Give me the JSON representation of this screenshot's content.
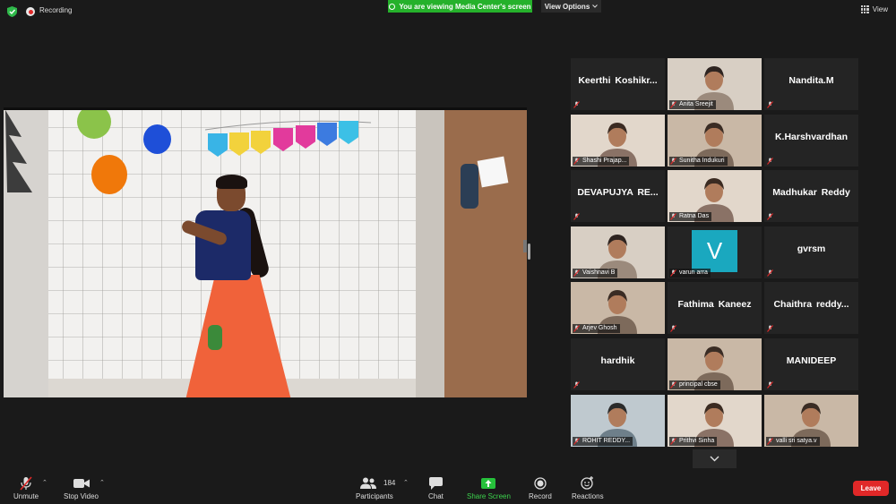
{
  "top_bar": {
    "recording_label": "Recording",
    "viewing_banner": "You are viewing Media Center's screen",
    "view_options_label": "View Options",
    "view_label": "View"
  },
  "gallery": {
    "tiles": [
      {
        "name": "Keerthi  Koshikr...",
        "video": false
      },
      {
        "name": "Anita Sreejit",
        "video": true
      },
      {
        "name": "Nandita.M",
        "video": false
      },
      {
        "name": "Shashi Prajap...",
        "video": true
      },
      {
        "name": "Sunitha Indukuri",
        "video": true
      },
      {
        "name": "K.Harshvardhan",
        "video": false
      },
      {
        "name": "DEVAPUJYA  RE...",
        "video": false
      },
      {
        "name": "Ratna Das",
        "video": true
      },
      {
        "name": "Madhukar Reddy",
        "video": false
      },
      {
        "name": "Vaishnavi B",
        "video": true,
        "active": true
      },
      {
        "name": "varun arra",
        "video": false,
        "avatar_letter": "V"
      },
      {
        "name": "gvrsm",
        "video": false
      },
      {
        "name": "Arjev Ghosh",
        "video": true
      },
      {
        "name": "Fathima Kaneez",
        "video": false
      },
      {
        "name": "Chaithra  reddy...",
        "video": false
      },
      {
        "name": "hardhik",
        "video": false
      },
      {
        "name": "principal cbse",
        "video": true
      },
      {
        "name": "MANIDEEP",
        "video": false
      },
      {
        "name": "ROHIT REDDY...",
        "video": true
      },
      {
        "name": "Prithvi Sinha",
        "video": true
      },
      {
        "name": "valli sri satya.v",
        "video": true
      }
    ]
  },
  "toolbar": {
    "unmute_label": "Unmute",
    "stop_video_label": "Stop Video",
    "participants_label": "Participants",
    "participants_count": "184",
    "chat_label": "Chat",
    "share_screen_label": "Share Screen",
    "record_label": "Record",
    "reactions_label": "Reactions",
    "leave_label": "Leave"
  },
  "colors": {
    "background": "#1a1a1a",
    "tile": "#242424",
    "banner_green": "#25b12b",
    "leave_red": "#e02828",
    "active_speaker": "#d4e15a",
    "avatar_teal": "#1aa8bf"
  }
}
